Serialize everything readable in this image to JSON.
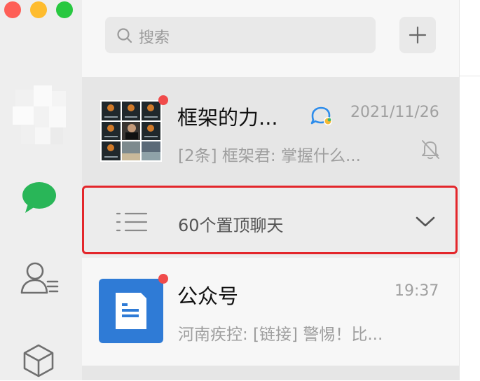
{
  "window": {
    "traffic_lights": {
      "close": "#fe5f57",
      "minimize": "#febc2e",
      "maximize": "#28c840"
    }
  },
  "sidebar": {
    "icons": [
      "user-avatar",
      "chat-icon",
      "contacts-icon",
      "mini-programs-icon"
    ],
    "chat_icon_color": "#29b658"
  },
  "search": {
    "placeholder": "搜索",
    "add_label": "+"
  },
  "chats": {
    "pinned": {
      "title": "框架的力...",
      "time": "2021/11/26",
      "preview": "[2条] 框架君: 掌握什么...",
      "unread_dot": true,
      "badge_icon": "chat-bubble-icon",
      "muted_icon": "bell-muted-icon"
    },
    "collapse": {
      "label": "60个置顶聊天"
    },
    "official": {
      "title": "公众号",
      "time": "19:37",
      "preview": "河南疾控: [链接] 警惕！比...",
      "unread_dot": true
    }
  },
  "highlight_color": "#e3262b"
}
